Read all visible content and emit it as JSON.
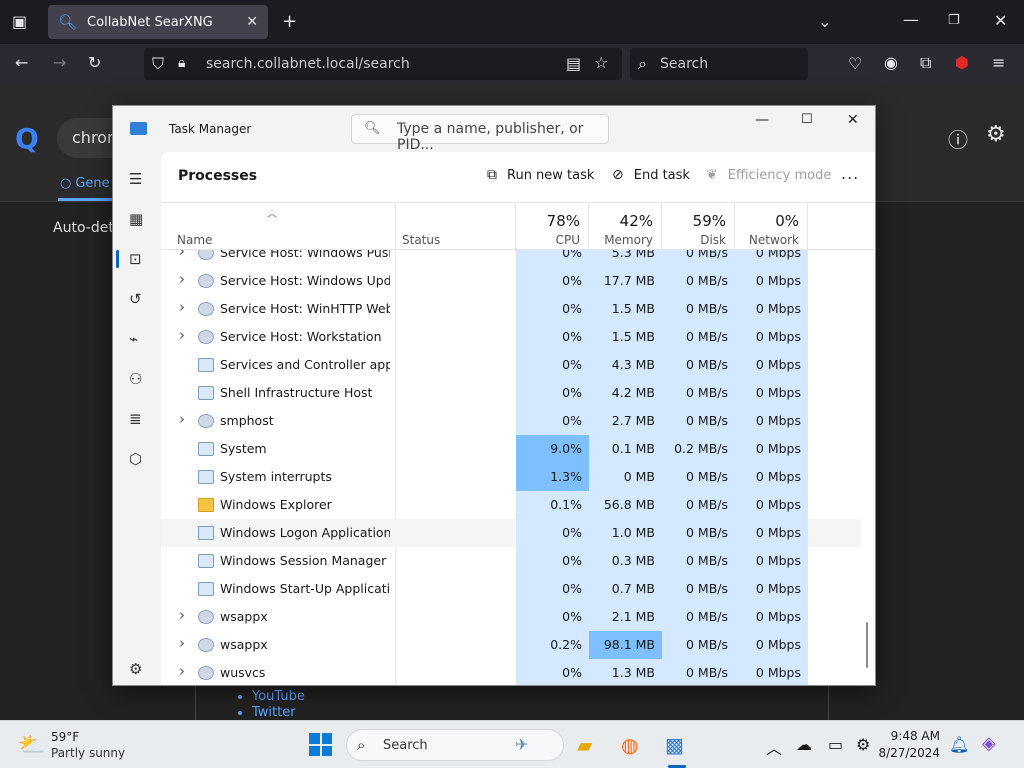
{
  "browser": {
    "tab_title": "CollabNet SearXNG",
    "url": "search.collabnet.local/search",
    "search_placeholder": "Search"
  },
  "page": {
    "query": "chrom",
    "general_tab": "Gene",
    "auto_detect": "Auto-detec",
    "links": [
      "YouTube",
      "Twitter"
    ]
  },
  "task_manager": {
    "title": "Task Manager",
    "search_placeholder": "Type a name, publisher, or PID...",
    "section_title": "Processes",
    "toolbar": {
      "run_new_task": "Run new task",
      "end_task": "End task",
      "efficiency_mode": "Efficiency mode",
      "more": "..."
    },
    "columns": {
      "name": "Name",
      "status": "Status",
      "cpu": {
        "label": "CPU",
        "pct": "78%"
      },
      "memory": {
        "label": "Memory",
        "pct": "42%"
      },
      "disk": {
        "label": "Disk",
        "pct": "59%"
      },
      "network": {
        "label": "Network",
        "pct": "0%"
      }
    },
    "rows": [
      {
        "name": "Service Host: Windows Push ...",
        "expand": true,
        "icon": "gear",
        "cpu": "0%",
        "memory": "5.3 MB",
        "disk": "0 MB/s",
        "network": "0 Mbps"
      },
      {
        "name": "Service Host: Windows Update",
        "expand": true,
        "icon": "gear",
        "cpu": "0%",
        "memory": "17.7 MB",
        "disk": "0 MB/s",
        "network": "0 Mbps"
      },
      {
        "name": "Service Host: WinHTTP Web P...",
        "expand": true,
        "icon": "gear",
        "cpu": "0%",
        "memory": "1.5 MB",
        "disk": "0 MB/s",
        "network": "0 Mbps"
      },
      {
        "name": "Service Host: Workstation",
        "expand": true,
        "icon": "gear",
        "cpu": "0%",
        "memory": "1.5 MB",
        "disk": "0 MB/s",
        "network": "0 Mbps"
      },
      {
        "name": "Services and Controller app",
        "expand": false,
        "icon": "window",
        "cpu": "0%",
        "memory": "4.3 MB",
        "disk": "0 MB/s",
        "network": "0 Mbps"
      },
      {
        "name": "Shell Infrastructure Host",
        "expand": false,
        "icon": "window",
        "cpu": "0%",
        "memory": "4.2 MB",
        "disk": "0 MB/s",
        "network": "0 Mbps"
      },
      {
        "name": "smphost",
        "expand": true,
        "icon": "gear",
        "cpu": "0%",
        "memory": "2.7 MB",
        "disk": "0 MB/s",
        "network": "0 Mbps"
      },
      {
        "name": "System",
        "expand": false,
        "icon": "window",
        "cpu": "9.0%",
        "memory": "0.1 MB",
        "disk": "0.2 MB/s",
        "network": "0 Mbps"
      },
      {
        "name": "System interrupts",
        "expand": false,
        "icon": "window",
        "cpu": "1.3%",
        "memory": "0 MB",
        "disk": "0 MB/s",
        "network": "0 Mbps"
      },
      {
        "name": "Windows Explorer",
        "expand": false,
        "icon": "folder",
        "cpu": "0.1%",
        "memory": "56.8 MB",
        "disk": "0 MB/s",
        "network": "0 Mbps"
      },
      {
        "name": "Windows Logon Application",
        "expand": false,
        "icon": "window",
        "cpu": "0%",
        "memory": "1.0 MB",
        "disk": "0 MB/s",
        "network": "0 Mbps"
      },
      {
        "name": "Windows Session Manager",
        "expand": false,
        "icon": "window",
        "cpu": "0%",
        "memory": "0.3 MB",
        "disk": "0 MB/s",
        "network": "0 Mbps"
      },
      {
        "name": "Windows Start-Up Application",
        "expand": false,
        "icon": "window",
        "cpu": "0%",
        "memory": "0.7 MB",
        "disk": "0 MB/s",
        "network": "0 Mbps"
      },
      {
        "name": "wsappx",
        "expand": true,
        "icon": "gear",
        "cpu": "0%",
        "memory": "2.1 MB",
        "disk": "0 MB/s",
        "network": "0 Mbps"
      },
      {
        "name": "wsappx",
        "expand": true,
        "icon": "gear",
        "cpu": "0.2%",
        "memory": "98.1 MB",
        "disk": "0 MB/s",
        "network": "0 Mbps"
      },
      {
        "name": "wusvcs",
        "expand": true,
        "icon": "gear",
        "cpu": "0%",
        "memory": "1.3 MB",
        "disk": "0 MB/s",
        "network": "0 Mbps"
      }
    ]
  },
  "taskbar": {
    "weather_temp": "59°F",
    "weather_desc": "Partly sunny",
    "search_label": "Search",
    "time": "9:48 AM",
    "date": "8/27/2024"
  },
  "colors": {
    "cell_light": "#d4e9ff",
    "cell_medium": "#a8d4ff",
    "cell_strong": "#7ec0ff",
    "accent": "#0067c0"
  }
}
